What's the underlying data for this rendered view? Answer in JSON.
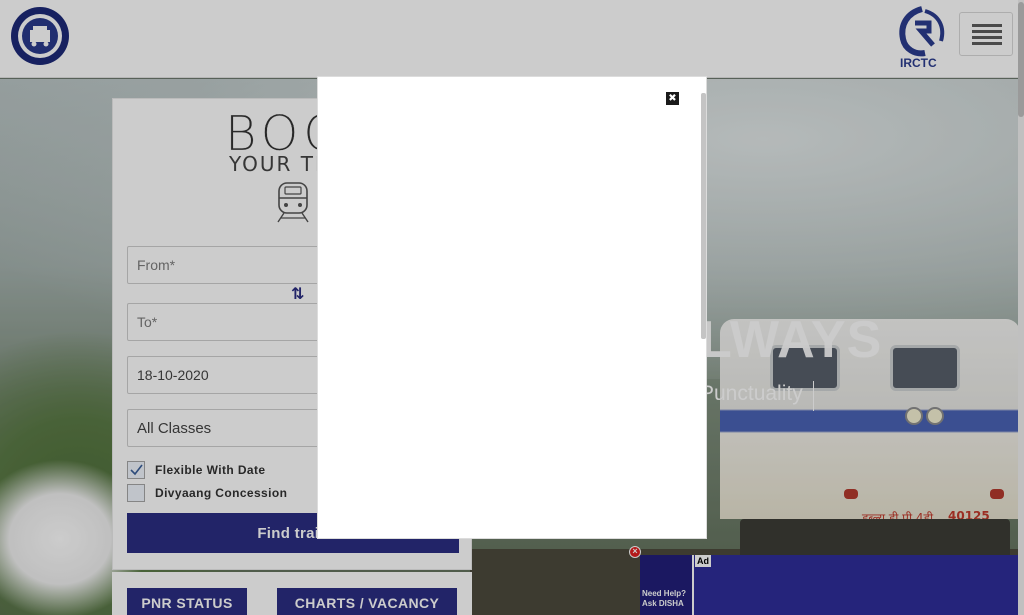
{
  "header": {
    "left_logo": "indian-railways-logo",
    "right_logo_text": "IRCTC",
    "menu_icon": "hamburger-menu-icon"
  },
  "hero": {
    "title_visible": "LWAYS",
    "tagline_visible": "Punctuality",
    "loco_number": "40125",
    "loco_script": "डब्ल्यू डी पी 4डी"
  },
  "booking": {
    "title_visible": "BOO",
    "subtitle_visible": "YOUR TIC",
    "from_placeholder": "From*",
    "to_placeholder": "To*",
    "date_value": "18-10-2020",
    "class_value": "All Classes",
    "swap_icon": "swap-arrows-icon",
    "flexible_label": "Flexible With Date",
    "flexible_checked": true,
    "divyaang_label": "Divyaang Concession",
    "divyaang_checked": false,
    "find_button_visible": "Find train"
  },
  "quick_actions": {
    "pnr_label": "PNR STATUS",
    "charts_label": "CHARTS / VACANCY"
  },
  "ad": {
    "help_line1": "Need Help?",
    "help_line2": "Ask DISHA",
    "ad_tag": "Ad",
    "close_icon": "ad-close-icon"
  },
  "modal": {
    "close_icon": "modal-close-icon"
  },
  "colors": {
    "brand_blue": "#2b2e82",
    "ad_blue": "#2f2d9a",
    "overlay": "rgba(0,0,0,0.2)"
  }
}
